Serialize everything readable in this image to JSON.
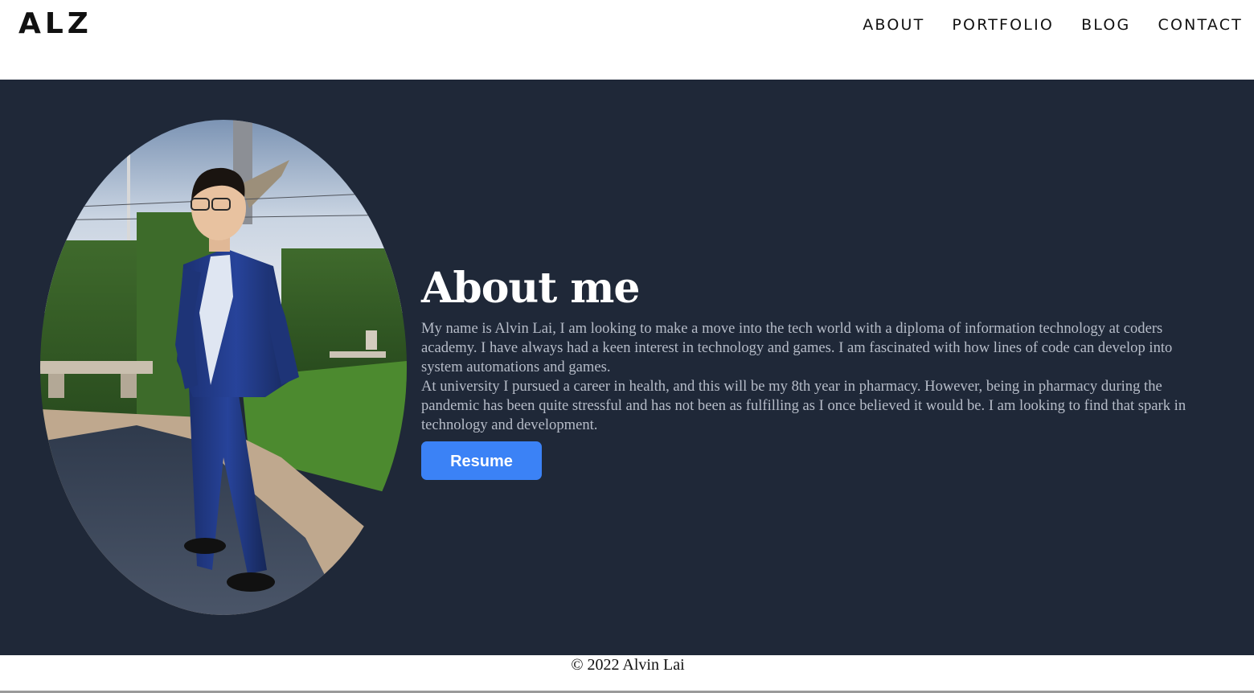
{
  "header": {
    "logo": "ALZ",
    "nav": [
      {
        "label": "ABOUT"
      },
      {
        "label": "PORTFOLIO"
      },
      {
        "label": "BLOG"
      },
      {
        "label": "CONTACT"
      }
    ]
  },
  "about": {
    "title": "About me",
    "paragraphs": [
      "My name is Alvin Lai, I am looking to make a move into the tech world with a diploma of information technology at coders academy. I have always had a keen interest in technology and games. I am fascinated with how lines of code can develop into system automations and games.",
      "At university I pursued a career in health, and this will be my 8th year in pharmacy. However, being in pharmacy during the pandemic has been quite stressful and has not been as fulfilling as I once believed it would be. I am looking to find that spark in technology and development."
    ],
    "resume_label": "Resume"
  },
  "footer": {
    "copyright": "© 2022 Alvin Lai"
  },
  "colors": {
    "hero_bg": "#1f2838",
    "button": "#3b82f6",
    "body_text": "#b6bcc8"
  }
}
